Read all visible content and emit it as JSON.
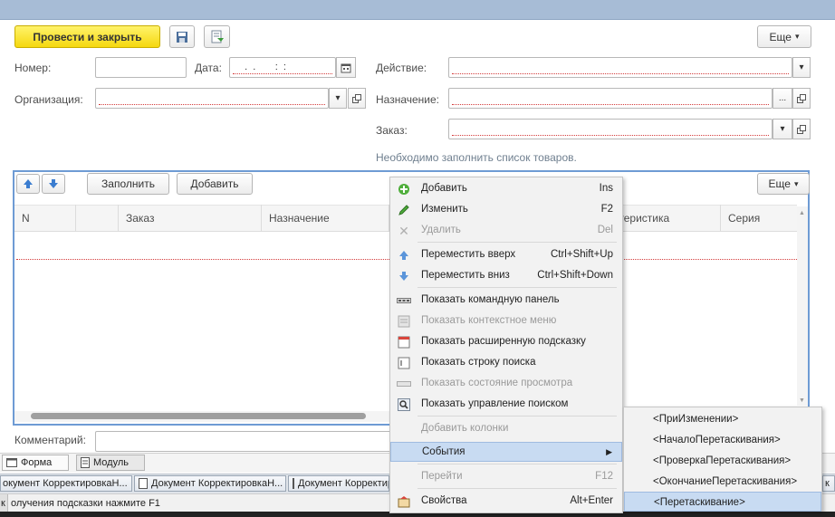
{
  "toolbar": {
    "post_close_label": "Провести и закрыть",
    "more_label": "Еще",
    "more_arrow": "▾"
  },
  "form": {
    "number_label": "Номер:",
    "number_value": "",
    "date_label": "Дата:",
    "date_value": "  .  .       :  :",
    "action_label": "Действие:",
    "org_label": "Организация:",
    "purpose_label": "Назначение:",
    "order_label": "Заказ:",
    "hint": "Необходимо заполнить список товаров.",
    "comment_label": "Комментарий:",
    "ellipsis": "...",
    "dropdown_arrow": "▾"
  },
  "table": {
    "fill_label": "Заполнить",
    "add_label": "Добавить",
    "more_label": "Еще",
    "columns": [
      "N",
      "",
      "Заказ",
      "Назначение",
      "ктеристика",
      "Серия"
    ]
  },
  "context_menu": {
    "items": [
      {
        "label": "Добавить",
        "shortcut": "Ins",
        "icon": "add-icon",
        "disabled": false
      },
      {
        "label": "Изменить",
        "shortcut": "F2",
        "icon": "edit-icon",
        "disabled": false
      },
      {
        "label": "Удалить",
        "shortcut": "Del",
        "icon": "delete-icon",
        "disabled": true
      },
      {
        "label": "Переместить вверх",
        "shortcut": "Ctrl+Shift+Up",
        "icon": "move-up-icon",
        "disabled": false
      },
      {
        "label": "Переместить вниз",
        "shortcut": "Ctrl+Shift+Down",
        "icon": "move-down-icon",
        "disabled": false
      },
      {
        "label": "Показать командную панель",
        "shortcut": "",
        "icon": "command-panel-icon",
        "disabled": false
      },
      {
        "label": "Показать контекстное меню",
        "shortcut": "",
        "icon": "context-menu-icon",
        "disabled": true
      },
      {
        "label": "Показать расширенную подсказку",
        "shortcut": "",
        "icon": "tooltip-icon",
        "disabled": false
      },
      {
        "label": "Показать строку поиска",
        "shortcut": "",
        "icon": "search-bar-icon",
        "disabled": false
      },
      {
        "label": "Показать состояние просмотра",
        "shortcut": "",
        "icon": "view-state-icon",
        "disabled": true
      },
      {
        "label": "Показать управление поиском",
        "shortcut": "",
        "icon": "search-icon",
        "disabled": false
      },
      {
        "label": "Добавить колонки",
        "shortcut": "",
        "icon": "",
        "disabled": true
      },
      {
        "label": "События",
        "shortcut": "▶",
        "icon": "",
        "disabled": false
      },
      {
        "label": "Перейти",
        "shortcut": "F12",
        "icon": "",
        "disabled": true
      },
      {
        "label": "Свойства",
        "shortcut": "Alt+Enter",
        "icon": "properties-icon",
        "disabled": false
      }
    ]
  },
  "events_submenu": {
    "items": [
      "<ПриИзменении>",
      "<НачалоПеретаскивания>",
      "<ПроверкаПеретаскивания>",
      "<ОкончаниеПеретаскивания>",
      "<Перетаскивание>"
    ]
  },
  "tabs": {
    "form_label": "Форма",
    "module_label": "Модуль"
  },
  "taskbar": {
    "items": [
      "окумент КорректировкаН...",
      "Документ КорректировкаН...",
      "Документ Корректиров",
      "к"
    ]
  },
  "status": {
    "text": "олучения подсказки нажмите F1",
    "prefix": "к"
  },
  "colors": {
    "accent_yellow": "#f5d80f",
    "frame_blue": "#6e9bd4",
    "selection": "#c8dbf2",
    "required_red": "#d43c3c"
  }
}
